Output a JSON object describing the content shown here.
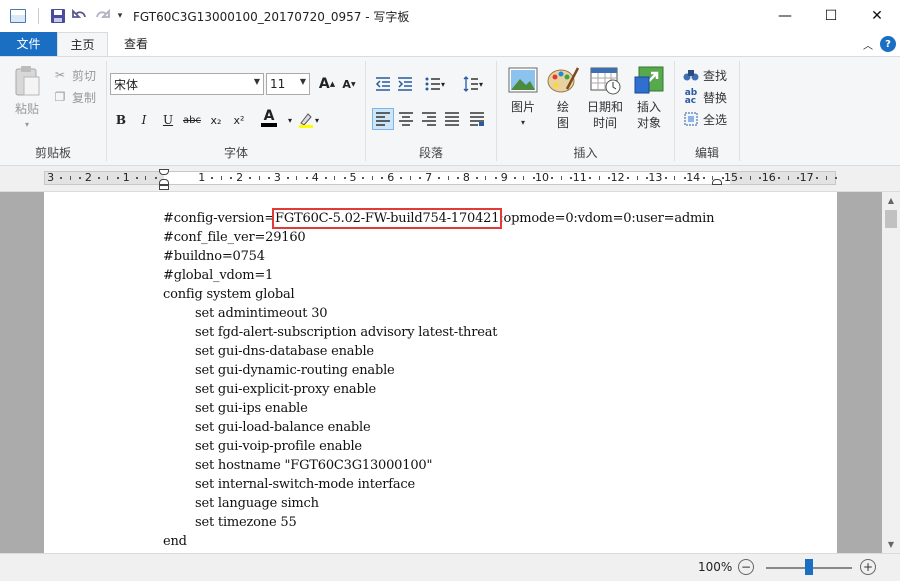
{
  "window": {
    "title": "FGT60C3G13000100_20170720_0957 - 写字板",
    "minimize": "—",
    "maximize": "☐",
    "close": "✕"
  },
  "quick_access": {
    "save_icon": "save-icon",
    "undo_icon": "undo-icon",
    "redo_icon": "redo-icon",
    "customize": "▾"
  },
  "tabs": [
    {
      "label": "文件"
    },
    {
      "label": "主页"
    },
    {
      "label": "查看"
    }
  ],
  "ribbon": {
    "clipboard": {
      "label": "剪贴板",
      "paste": "粘贴",
      "cut": "剪切",
      "copy": "复制"
    },
    "font": {
      "label": "字体",
      "family": "宋体",
      "size": "11",
      "grow": "A",
      "shrink": "A",
      "bold": "B",
      "italic": "I",
      "underline": "U",
      "strike": "abc",
      "subscript": "x₂",
      "superscript": "x²",
      "color_letter": "A",
      "text_color": "#000000",
      "highlight_color": "#ffff00"
    },
    "paragraph": {
      "label": "段落"
    },
    "insert": {
      "label": "插入",
      "picture": "图片",
      "paint_line1": "绘",
      "paint_line2": "图",
      "datetime_line1": "日期和",
      "datetime_line2": "时间",
      "object_line1": "插入",
      "object_line2": "对象"
    },
    "editing": {
      "label": "编辑",
      "find": "查找",
      "replace": "替换",
      "select_all": "全选"
    }
  },
  "ruler": {
    "labels": [
      "3",
      "2",
      "1",
      "1",
      "2",
      "3",
      "4",
      "5",
      "6",
      "7",
      "8",
      "9",
      "10",
      "11",
      "12",
      "13",
      "14",
      "15",
      "16",
      "17"
    ]
  },
  "document": {
    "line1_prefix": "#config-version=",
    "line1_highlight": "FGT60C-5.02-FW-build754-170421",
    "line1_suffix": ":opmode=0:vdom=0:user=admin",
    "lines": [
      "#conf_file_ver=29160",
      "#buildno=0754",
      "#global_vdom=1",
      "config system global"
    ],
    "indented_lines": [
      "set admintimeout 30",
      "set fgd-alert-subscription advisory latest-threat",
      "set gui-dns-database enable",
      "set gui-dynamic-routing enable",
      "set gui-explicit-proxy enable",
      "set gui-ips enable",
      "set gui-load-balance enable",
      "set gui-voip-profile enable",
      "set hostname \"FGT60C3G13000100\"",
      "set internal-switch-mode interface",
      "set language simch",
      "set timezone 55"
    ],
    "last_line": "end",
    "highlight_color": "#e53935"
  },
  "status": {
    "zoom": "100%",
    "zoom_fraction": 0.5,
    "zoom_out": "−",
    "zoom_in": "+"
  }
}
